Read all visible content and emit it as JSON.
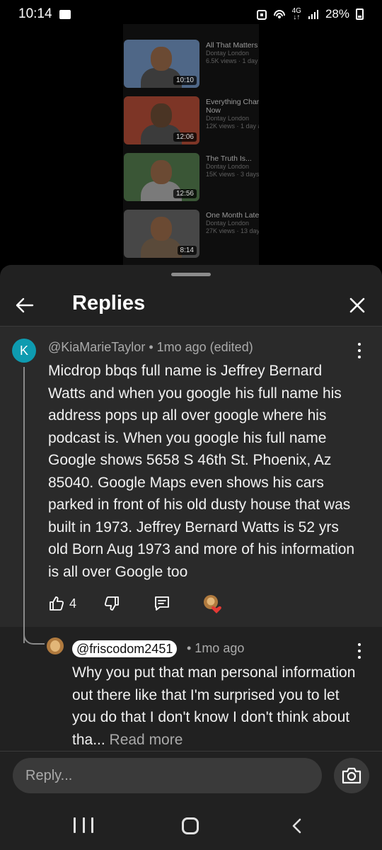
{
  "status_bar": {
    "time": "10:14",
    "battery": "28%"
  },
  "background_videos": [
    {
      "title": "All That Matters",
      "channel": "Dontay London",
      "stats": "6.5K views · 1 day",
      "duration": "10:10",
      "bg": "#5a7090"
    },
    {
      "title": "Everything Char Now",
      "channel": "Dontay London",
      "stats": "12K views · 1 day a",
      "duration": "12:06",
      "bg": "#8a3b2a"
    },
    {
      "title": "The Truth Is...",
      "channel": "Dontay London",
      "stats": "15K views · 3 days",
      "duration": "12:56",
      "bg": "#3d5a3a"
    },
    {
      "title": "One Month Late",
      "channel": "Dontay London",
      "stats": "27K views · 13 day",
      "duration": "8:14",
      "bg": "#4a4a4a"
    }
  ],
  "sheet": {
    "title": "Replies"
  },
  "comment": {
    "avatar_letter": "K",
    "author": "@KiaMarieTaylor",
    "meta": " • 1mo ago (edited)",
    "text": "Micdrop bbqs full name is Jeffrey Bernard Watts and when you google his full name his address pops up all over google where his podcast is. When you google his full name Google shows 5658 S 46th St. Phoenix, Az 85040. Google Maps even shows his cars parked in front of his old dusty house that was built in 1973. Jeffrey Bernard Watts is 52 yrs old Born Aug 1973 and more of his information is all over Google too",
    "likes": "4"
  },
  "reply": {
    "author": "@friscodom2451",
    "meta": "• 1mo ago",
    "text": "Why you put that man personal information out there like that I'm surprised you to let you do that I don't know I don't think about tha... ",
    "read_more": "Read more"
  },
  "composer": {
    "placeholder": "Reply..."
  },
  "colors": {
    "sheet_bg": "#212121",
    "highlight_bg": "#2a2a2a",
    "avatar_k": "#0e9bb0",
    "heart": "#e53935"
  }
}
